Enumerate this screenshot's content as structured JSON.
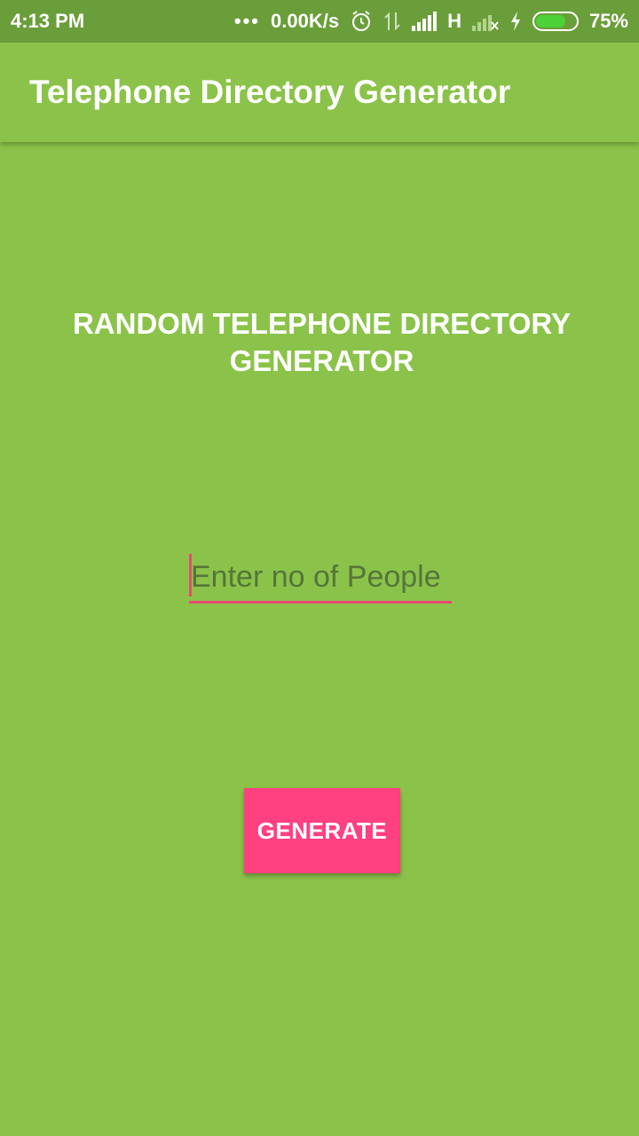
{
  "status_bar": {
    "time": "4:13 PM",
    "dots": "•••",
    "network_speed": "0.00K/s",
    "network_type": "H",
    "battery_percent": "75%",
    "battery_level": 0.75,
    "icons": [
      "alarm-icon",
      "data-transfer-icon",
      "signal-icon",
      "signal-no-service-icon",
      "charging-icon",
      "battery-icon"
    ]
  },
  "app_bar": {
    "title": "Telephone Directory Generator"
  },
  "main": {
    "heading": "RANDOM TELEPHONE DIRECTORY GENERATOR",
    "input": {
      "value": "",
      "placeholder": "Enter no of People"
    },
    "generate_label": "GENERATE"
  },
  "colors": {
    "background": "#8bc34a",
    "status_bar": "#6a9e3a",
    "accent": "#ff4081",
    "underline": "#e84a72"
  }
}
